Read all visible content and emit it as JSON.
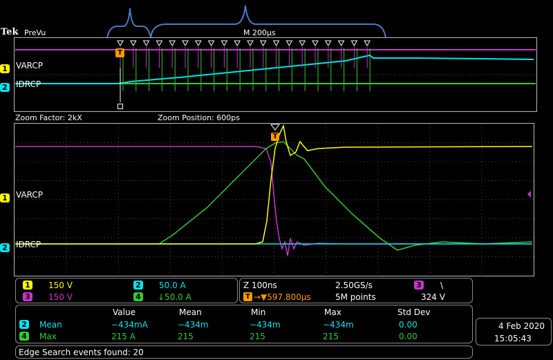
{
  "header": {
    "brand": "Tek",
    "mode": "PreVu",
    "timebase": "M 200µs"
  },
  "overview": {
    "ch1_label": "VARCP",
    "ch2_label": "IDRCP",
    "ch1_marker": "1",
    "ch2_marker": "2",
    "trigger_marker": "T"
  },
  "zoom": {
    "factor_text": "Zoom Factor: 2kX",
    "position_text": "Zoom Position: 600ps",
    "ch1_label": "VARCP",
    "ch2_label": "IDRCP",
    "ch1_marker": "1",
    "ch2_marker": "2",
    "trigger_marker": "T"
  },
  "channels": {
    "ch1": {
      "num": "1",
      "scale": "150 V",
      "color": "#ffff00"
    },
    "ch2": {
      "num": "2",
      "scale": "50.0 A",
      "color": "#00e5ee"
    },
    "ch3": {
      "num": "3",
      "scale": "150 V",
      "color": "#cc33cc"
    },
    "ch4": {
      "num": "4",
      "scale": "↓50.0 A",
      "color": "#33cc33"
    }
  },
  "acquisition": {
    "zoom_scale": "Z 100ns",
    "sample_rate": "2.50GS/s",
    "trigger_time": "→▼597.800µs",
    "record_length": "5M points",
    "trigger_source": "3",
    "trigger_slope": "\\",
    "trigger_level": "324 V"
  },
  "measurements": {
    "headers": [
      "Value",
      "Mean",
      "Min",
      "Max",
      "Std Dev"
    ],
    "rows": [
      {
        "ch": "2",
        "name": "Mean",
        "color": "#00e5ee",
        "value": "−434mA",
        "mean": "−434m",
        "min": "−434m",
        "max": "−434m",
        "std": "0.00"
      },
      {
        "ch": "4",
        "name": "Max",
        "color": "#33cc33",
        "value": "215 A",
        "mean": "215",
        "min": "215",
        "max": "215",
        "std": "0.00"
      }
    ]
  },
  "datetime": {
    "date": "4 Feb  2020",
    "time": "15:05:43"
  },
  "status": {
    "search_text": "Edge Search events found: 20"
  },
  "colors": {
    "ch1": "#ffff00",
    "ch2": "#00e5ee",
    "ch3": "#cc33cc",
    "ch4": "#33cc33",
    "trigger": "#ff9900",
    "annotation": "#4a7cc4"
  }
}
